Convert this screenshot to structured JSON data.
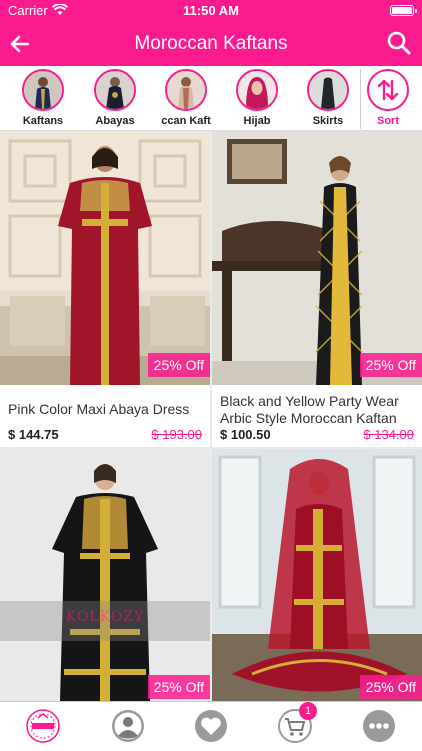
{
  "status_bar": {
    "carrier": "Carrier",
    "time": "11:50 AM"
  },
  "nav": {
    "title": "Moroccan Kaftans"
  },
  "colors": {
    "brand": "#fb1b8e",
    "badge": "#fb1b8e"
  },
  "categories": [
    {
      "label": "Kaftans",
      "icon": "kaftan-thumb"
    },
    {
      "label": "Abayas",
      "icon": "abaya-thumb"
    },
    {
      "label": "ccan Kaft",
      "icon": "moroccan-kaftan-thumb"
    },
    {
      "label": "Hijab",
      "icon": "hijab-thumb"
    },
    {
      "label": "Skirts",
      "icon": "skirt-thumb"
    }
  ],
  "sort": {
    "label": "Sort"
  },
  "products": [
    {
      "name": "Pink Color Maxi Abaya Dress",
      "price": "$ 144.75",
      "old_price": "$ 193.00",
      "badge": "25% Off"
    },
    {
      "name": "Black and Yellow Party Wear Arbic Style Moroccan Kaftan",
      "price": "$ 100.50",
      "old_price": "$ 134.00",
      "badge": "25% Off"
    },
    {
      "name": "",
      "price": "",
      "old_price": "",
      "badge": "25% Off",
      "watermark": "KOLKOZY"
    },
    {
      "name": "",
      "price": "",
      "old_price": "",
      "badge": "25% Off"
    }
  ],
  "tabbar": {
    "items": [
      {
        "icon": "home-logo-icon"
      },
      {
        "icon": "profile-icon"
      },
      {
        "icon": "heart-icon"
      },
      {
        "icon": "cart-icon",
        "badge": "1"
      },
      {
        "icon": "more-icon"
      }
    ]
  }
}
